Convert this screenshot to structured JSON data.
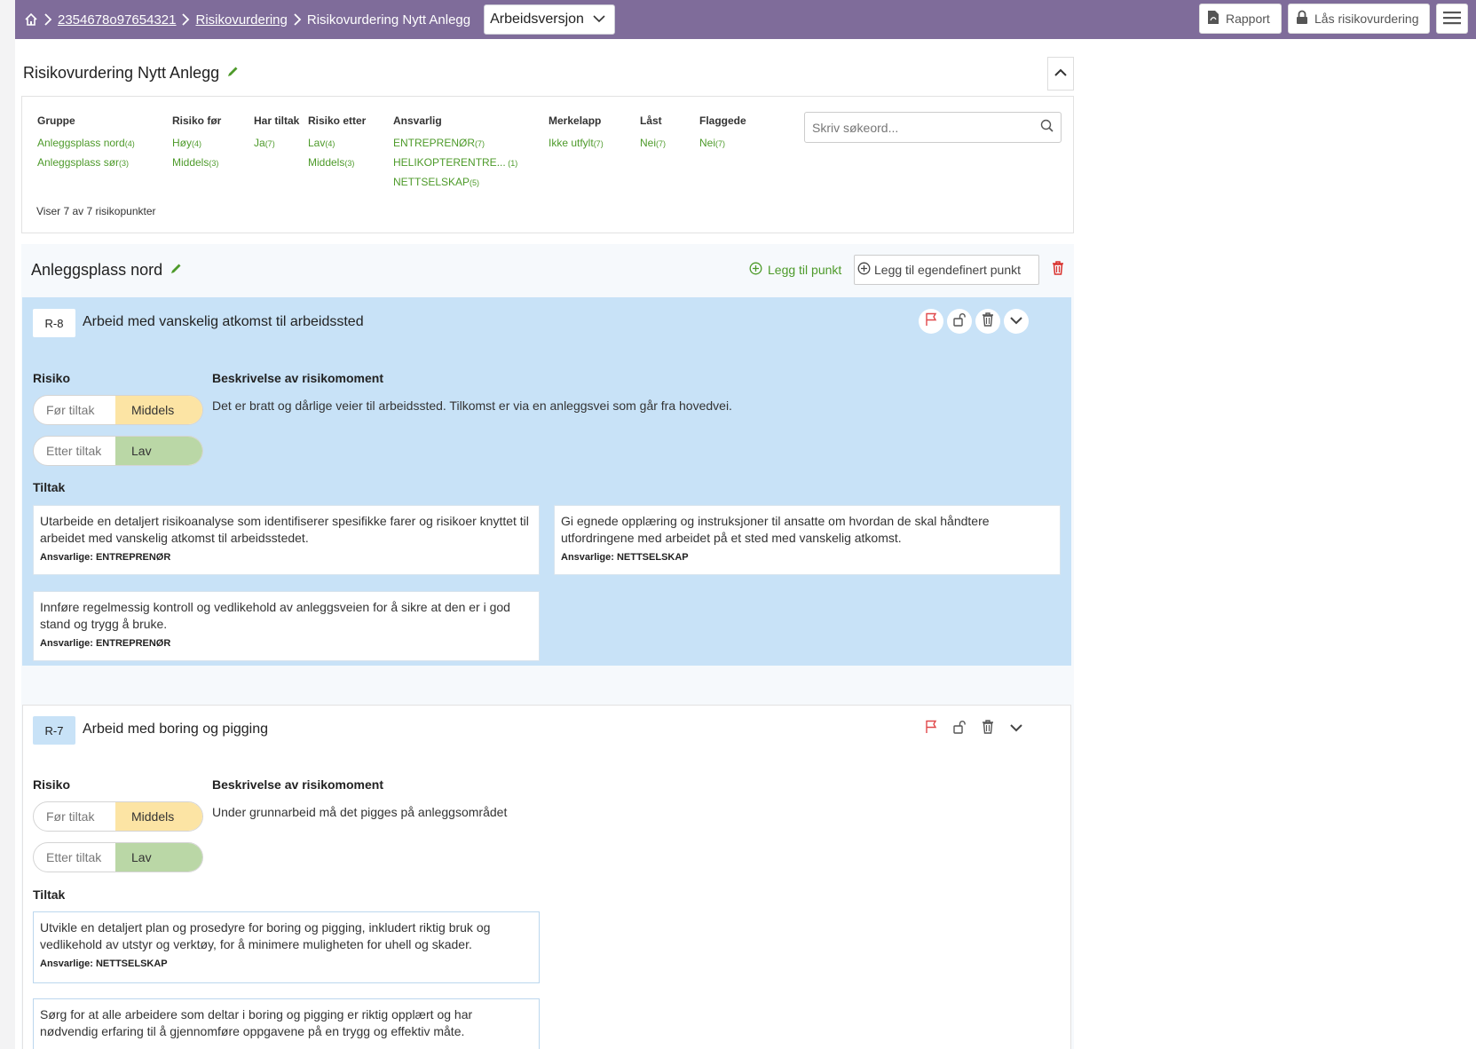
{
  "breadcrumb": {
    "project": "2354678o97654321",
    "section": "Risikovurdering",
    "current": "Risikovurdering Nytt Anlegg",
    "version": "Arbeidsversjon"
  },
  "toolbar": {
    "report": "Rapport",
    "lock": "Lås risikovurdering"
  },
  "page": {
    "title": "Risikovurdering Nytt Anlegg"
  },
  "filters": {
    "gruppe": {
      "header": "Gruppe",
      "items": [
        {
          "label": "Anleggsplass nord",
          "count": "(4)"
        },
        {
          "label": "Anleggsplass sør",
          "count": "(3)"
        }
      ]
    },
    "risiko_for": {
      "header": "Risiko før",
      "items": [
        {
          "label": "Høy",
          "count": "(4)"
        },
        {
          "label": "Middels",
          "count": "(3)"
        }
      ]
    },
    "har_tiltak": {
      "header": "Har tiltak",
      "items": [
        {
          "label": "Ja",
          "count": "(7)"
        }
      ]
    },
    "risiko_etter": {
      "header": "Risiko etter",
      "items": [
        {
          "label": "Lav",
          "count": "(4)"
        },
        {
          "label": "Middels",
          "count": "(3)"
        }
      ]
    },
    "ansvarlig": {
      "header": "Ansvarlig",
      "items": [
        {
          "label": "ENTREPRENØR",
          "count": "(7)"
        },
        {
          "label": "HELIKOPTERENTRE...",
          "count": " (1)"
        },
        {
          "label": "NETTSELSKAP",
          "count": "(5)"
        }
      ]
    },
    "merkelapp": {
      "header": "Merkelapp",
      "items": [
        {
          "label": "Ikke utfylt",
          "count": "(7)"
        }
      ]
    },
    "last": {
      "header": "Låst",
      "items": [
        {
          "label": "Nei",
          "count": "(7)"
        }
      ]
    },
    "flaggede": {
      "header": "Flaggede",
      "items": [
        {
          "label": "Nei",
          "count": "(7)"
        }
      ]
    },
    "search_placeholder": "Skriv søkeord...",
    "showing": "Viser 7 av 7 risikopunkter"
  },
  "group": {
    "title": "Anleggsplass nord",
    "add_point": "Legg til punkt",
    "add_custom_point": "Legg til egendefinert punkt"
  },
  "labels": {
    "risk": "Risiko",
    "description": "Beskrivelse av risikomoment",
    "measures": "Tiltak",
    "before": "Før tiltak",
    "after": "Etter tiltak"
  },
  "risks": [
    {
      "id": "R-8",
      "title": "Arbeid med vanskelig atkomst til arbeidssted",
      "before": "Middels",
      "after": "Lav",
      "description": "Det er bratt og dårlige veier til arbeidssted. Tilkomst er via en anleggsvei som går fra hovedvei.",
      "measures": [
        {
          "text": "Utarbeide en detaljert risikoanalyse som identifiserer spesifikke farer og risikoer knyttet til arbeidet med vanskelig atkomst til arbeidsstedet.",
          "resp": "Ansvarlige: ENTREPRENØR"
        },
        {
          "text": "Gi egnede opplæring og instruksjoner til ansatte om hvordan de skal håndtere utfordringene med arbeidet på et sted med vanskelig atkomst.",
          "resp": "Ansvarlige: NETTSELSKAP"
        },
        {
          "text": "Innføre regelmessig kontroll og vedlikehold av anleggsveien for å sikre at den er i god stand og trygg å bruke.",
          "resp": "Ansvarlige: ENTREPRENØR"
        }
      ]
    },
    {
      "id": "R-7",
      "title": "Arbeid med boring og pigging",
      "before": "Middels",
      "after": "Lav",
      "description": "Under grunnarbeid må det pigges på anleggsområdet",
      "measures": [
        {
          "text": "Utvikle en detaljert plan og prosedyre for boring og pigging, inkludert riktig bruk og vedlikehold av utstyr og verktøy, for å minimere muligheten for uhell og skader.",
          "resp": "Ansvarlige: NETTSELSKAP"
        },
        {
          "text": "Sørg for at alle arbeidere som deltar i boring og pigging er riktig opplært og har nødvendig erfaring til å gjennomføre oppgavene på en trygg og effektiv måte.",
          "resp": ""
        }
      ]
    }
  ],
  "colors": {
    "header": "#7f6c9a",
    "accent": "#4d9a2a",
    "selected": "#c8e2f7",
    "medium": "#fce4a4",
    "low": "#bad7a6",
    "danger": "#d9302c"
  }
}
